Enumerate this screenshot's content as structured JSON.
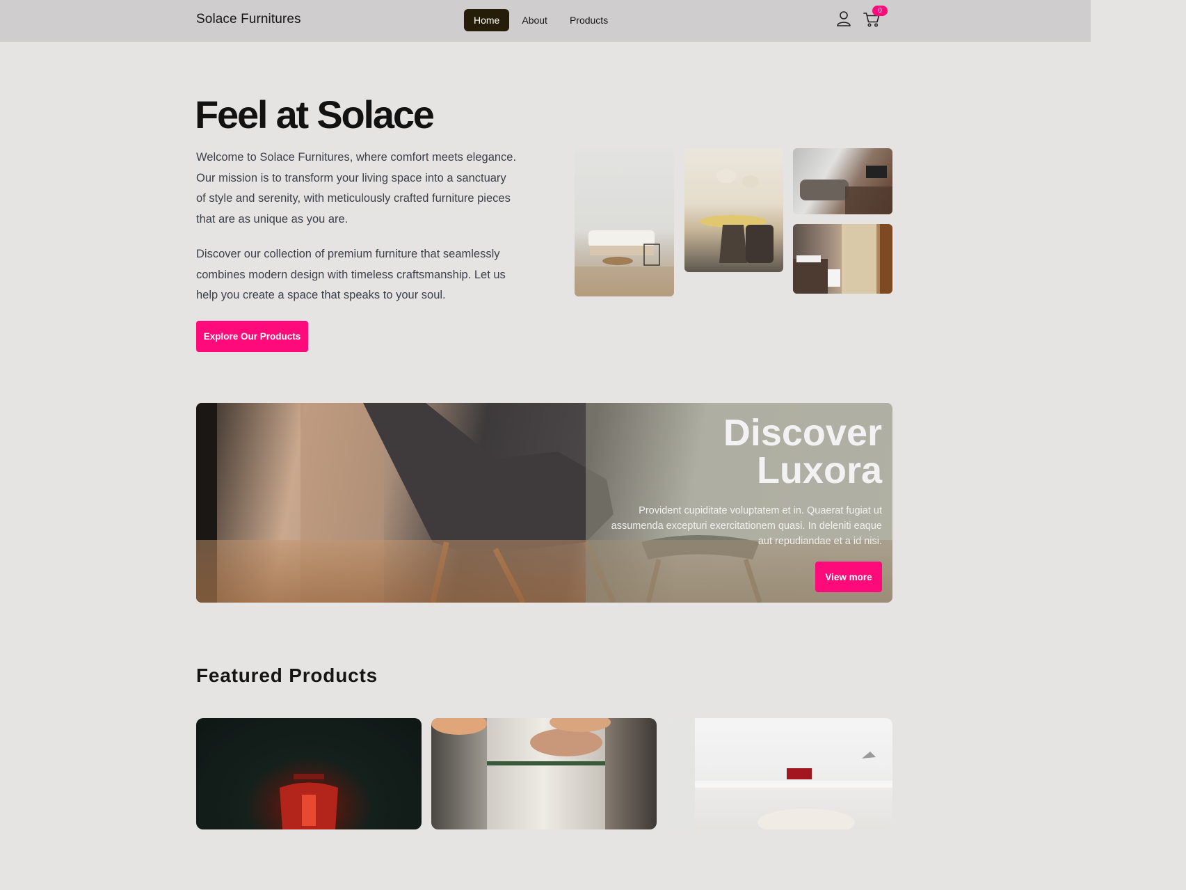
{
  "nav": {
    "brand": "Solace Furnitures",
    "links": [
      {
        "label": "Home",
        "active": true
      },
      {
        "label": "About",
        "active": false
      },
      {
        "label": "Products",
        "active": false
      }
    ],
    "cart_count": "0",
    "icons": [
      "user-icon",
      "cart-icon"
    ]
  },
  "hero": {
    "title": "Feel at Solace",
    "paragraph1": "Welcome to Solace Furnitures, where comfort meets elegance. Our mission is to transform your living space into a sanctuary of style and serenity, with meticulously crafted furniture pieces that are as unique as you are.",
    "paragraph2": "Discover our collection of premium furniture that seamlessly combines modern design with timeless craftsmanship. Let us help you create a space that speaks to your soul.",
    "cta_label": "Explore Our Products"
  },
  "banner": {
    "title_line1": "Discover",
    "title_line2": "Luxora",
    "text": "Provident cupiditate voluptatem et in. Quaerat fugiat ut assumenda excepturi exercitationem quasi. In deleniti eaque aut repudiandae et a id nisi.",
    "button_label": "View more"
  },
  "featured": {
    "title": "Featured Products"
  },
  "colors": {
    "accent": "#ff0a7a",
    "nav_active": "#261d08",
    "background": "#e6e4e2",
    "navbar": "#cfcdcd"
  }
}
